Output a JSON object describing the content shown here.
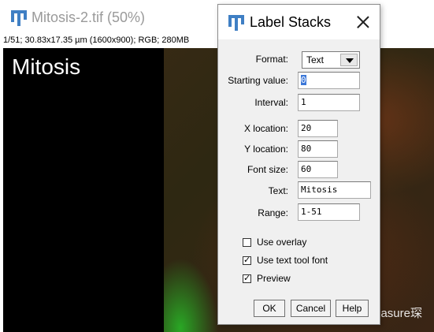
{
  "image_window": {
    "title": "Mitosis-2.tif (50%)",
    "info": "1/51; 30.83x17.35 µm (1600x900); RGB; 280MB",
    "canvas_label": "Mitosis",
    "watermark": "知乎 @Treasure琛"
  },
  "dialog": {
    "title": "Label Stacks",
    "fields": {
      "format": {
        "label": "Format:",
        "value": "Text"
      },
      "starting_value": {
        "label": "Starting value:",
        "value": "0"
      },
      "interval": {
        "label": "Interval:",
        "value": "1"
      },
      "x_location": {
        "label": "X location:",
        "value": "20"
      },
      "y_location": {
        "label": "Y location:",
        "value": "80"
      },
      "font_size": {
        "label": "Font size:",
        "value": "60"
      },
      "text": {
        "label": "Text:",
        "value": "Mitosis"
      },
      "range": {
        "label": "Range:",
        "value": "1-51"
      }
    },
    "checkboxes": {
      "use_overlay": {
        "label": "Use overlay",
        "checked": false
      },
      "use_text_tool_font": {
        "label": "Use text tool font",
        "checked": true
      },
      "preview": {
        "label": "Preview",
        "checked": true
      }
    },
    "buttons": {
      "ok": "OK",
      "cancel": "Cancel",
      "help": "Help"
    }
  },
  "colors": {
    "accent_icon": "#3f7fc4",
    "selection": "#3b77d8"
  },
  "icons": {
    "app_icon": "imagej-icon",
    "close": "close-icon",
    "dropdown": "chevron-down-icon"
  }
}
